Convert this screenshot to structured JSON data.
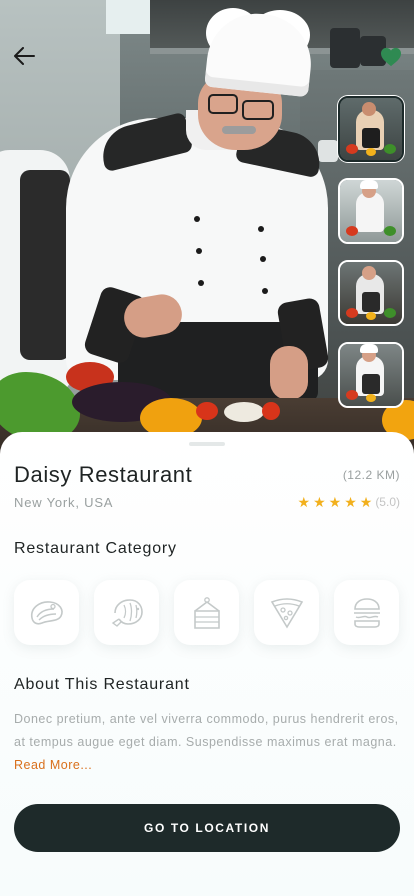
{
  "nav": {
    "back_icon": "arrow-left-icon",
    "favorite_icon": "heart-icon",
    "favorite_color": "#2f8a52"
  },
  "gallery": {
    "selected_index": 0,
    "thumbnails": [
      "chef-photo-1",
      "chef-photo-2",
      "chef-photo-3",
      "chef-photo-4"
    ]
  },
  "restaurant": {
    "name": "Daisy Restaurant",
    "distance": "(12.2 KM)",
    "location": "New York, USA",
    "rating": 5,
    "rating_label": "(5.0)",
    "star_color": "#f2b01d"
  },
  "categories": {
    "title": "Restaurant Category",
    "items": [
      "steak-icon",
      "shrimp-icon",
      "cake-icon",
      "pizza-icon",
      "burger-icon"
    ]
  },
  "about": {
    "title": "About This Restaurant",
    "text": "Donec pretium, ante vel viverra commodo, purus hendrerit eros, at tempus augue eget diam. Suspendisse maximus erat magna.",
    "read_more": "Read More..."
  },
  "cta": {
    "label": "GO TO LOCATION",
    "color": "#1e2a2a"
  }
}
